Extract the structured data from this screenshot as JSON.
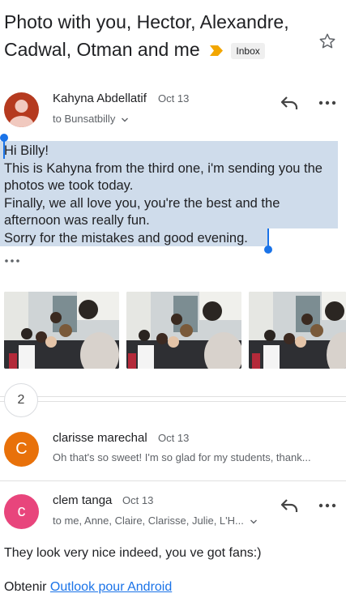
{
  "subject": {
    "title": "Photo with you, Hector, Alexandre, Cadwal, Otman and me",
    "label_chip": "Inbox"
  },
  "message1": {
    "sender": "Kahyna Abdellatif",
    "date": "Oct 13",
    "recipient": "to Bunsatbilly",
    "body": "Hi Billy!\nThis is Kahyna from the third one, i'm sending you the photos we took today.\nFinally, we all love you, you're the best and the afternoon was really fun.\nSorry for the mistakes and good evening."
  },
  "collapsed": {
    "count": "2"
  },
  "message2": {
    "avatar_letter": "C",
    "sender": "clarisse marechal",
    "date": "Oct 13",
    "snippet": "Oh that's so sweet! I'm so glad for my students, thank..."
  },
  "message3": {
    "avatar_letter": "c",
    "sender": "clem tanga",
    "date": "Oct 13",
    "recipient": "to me, Anne, Claire, Clarisse, Julie, L'H...",
    "body": "They look very nice indeed, you ve got fans:)",
    "signature_prefix": "Obtenir",
    "signature_link": "Outlook pour Android"
  },
  "colors": {
    "avatar_c1": "#e8710a",
    "avatar_c2": "#e8457c",
    "important": "#f2a600",
    "link": "#1a73e8",
    "selection": "#cfdceb"
  },
  "icons": [
    "star-icon",
    "reply-icon",
    "more-icon",
    "chevron-down-icon",
    "important-marker-icon"
  ]
}
